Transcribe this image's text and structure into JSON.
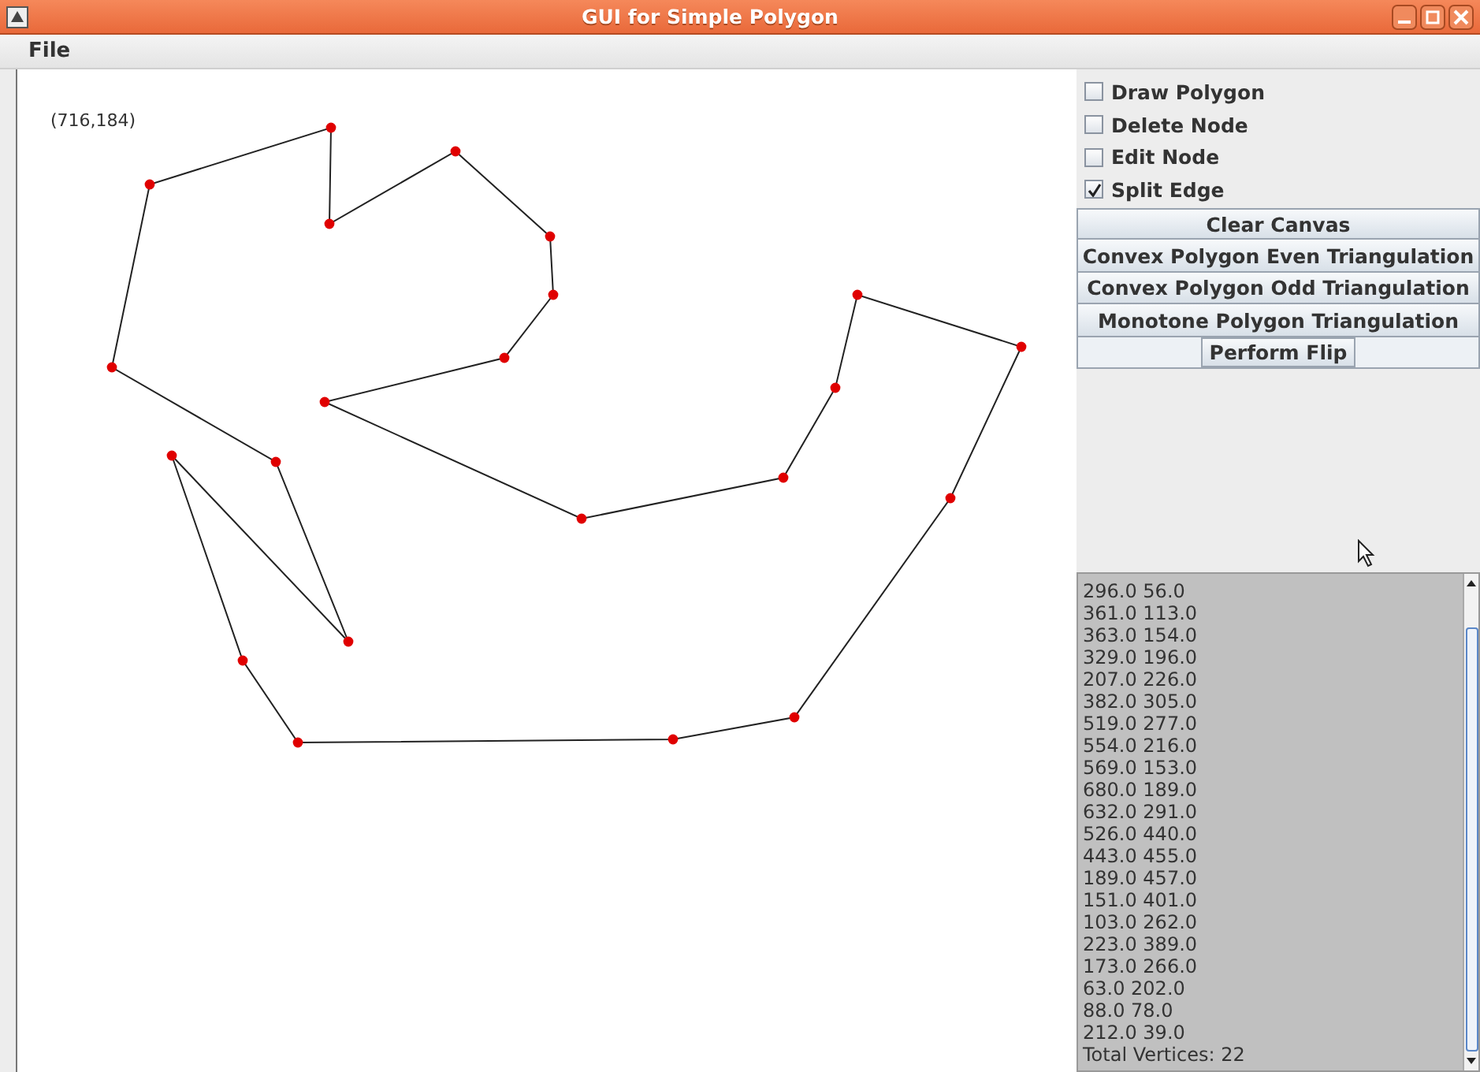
{
  "window": {
    "title": "GUI for Simple Polygon"
  },
  "menu": [
    "File"
  ],
  "canvas": {
    "cursor_readout": "(716,184)"
  },
  "options": [
    {
      "label": "Draw Polygon",
      "checked": false
    },
    {
      "label": "Delete Node",
      "checked": false
    },
    {
      "label": "Edit Node",
      "checked": false
    },
    {
      "label": "Split Edge",
      "checked": true
    }
  ],
  "buttons": [
    {
      "label": "Clear Canvas",
      "kind": "wide"
    },
    {
      "label": "Convex Polygon Even Triangulation",
      "kind": "wide"
    },
    {
      "label": "Convex Polygon Odd Triangulation",
      "kind": "wide"
    },
    {
      "label": "Monotone Polygon Triangulation",
      "kind": "wide"
    },
    {
      "label": "Perform Flip",
      "kind": "compact"
    }
  ],
  "vertex_list": {
    "lines": [
      "296.0 56.0",
      "361.0 113.0",
      "363.0 154.0",
      "329.0 196.0",
      "207.0 226.0",
      "382.0 305.0",
      "519.0 277.0",
      "554.0 216.0",
      "569.0 153.0",
      "680.0 189.0",
      "632.0 291.0",
      "526.0 440.0",
      "443.0 455.0",
      "189.0 457.0",
      "151.0 401.0",
      "103.0 262.0",
      "223.0 389.0",
      "173.0 266.0",
      "63.0 202.0",
      "88.0 78.0",
      "212.0 39.0"
    ],
    "total": "Total Vertices: 22"
  }
}
